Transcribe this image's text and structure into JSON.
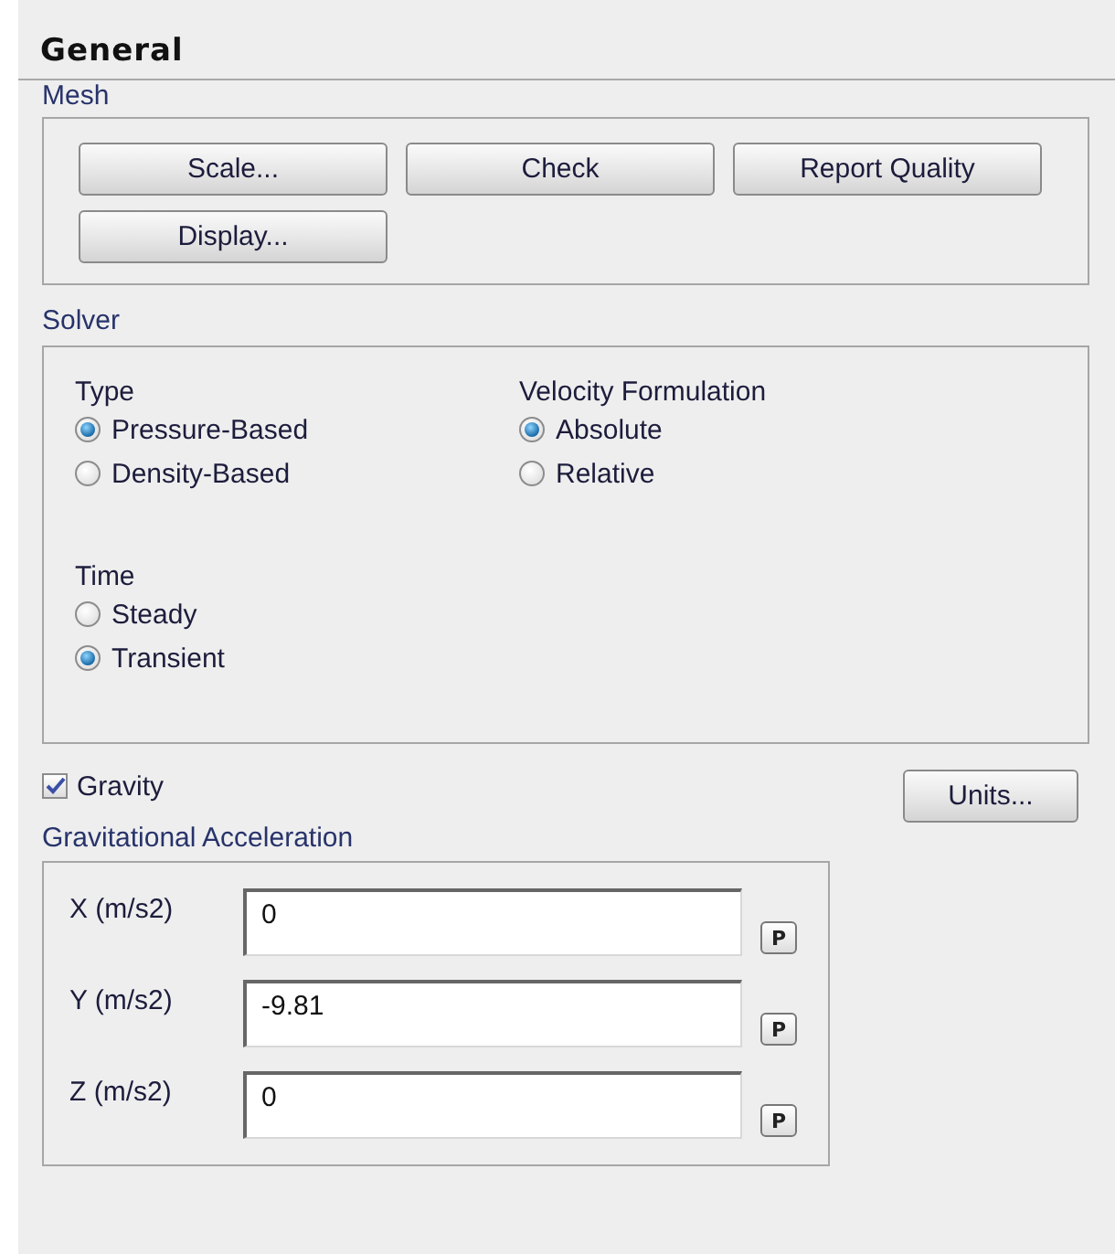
{
  "panel": {
    "title": "General"
  },
  "mesh": {
    "label": "Mesh",
    "buttons": [
      "Scale...",
      "Check",
      "Report Quality",
      "Display..."
    ]
  },
  "solver": {
    "label": "Solver",
    "groups": [
      {
        "label": "Type",
        "options": [
          {
            "label": "Pressure-Based",
            "selected": true
          },
          {
            "label": "Density-Based",
            "selected": false
          }
        ]
      },
      {
        "label": "Velocity Formulation",
        "options": [
          {
            "label": "Absolute",
            "selected": true
          },
          {
            "label": "Relative",
            "selected": false
          }
        ]
      },
      {
        "label": "Time",
        "options": [
          {
            "label": "Steady",
            "selected": false
          },
          {
            "label": "Transient",
            "selected": true
          }
        ]
      }
    ]
  },
  "gravity": {
    "label": "Gravity",
    "checked": true
  },
  "units_button": "Units...",
  "acceleration": {
    "label": "Gravitational Acceleration",
    "rows": [
      {
        "label": "X (m/s2)",
        "value": "0",
        "parameter_button": "P"
      },
      {
        "label": "Y (m/s2)",
        "value": "-9.81",
        "parameter_button": "P"
      },
      {
        "label": "Z (m/s2)",
        "value": "0",
        "parameter_button": "P"
      }
    ]
  }
}
